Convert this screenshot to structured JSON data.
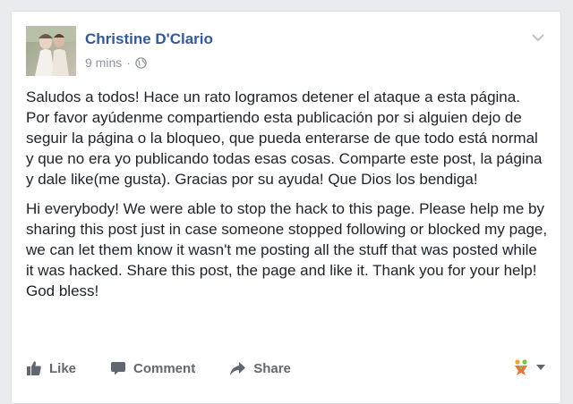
{
  "post": {
    "author": "Christine D'Clario",
    "time": "9 mins",
    "separator": "·",
    "privacy_icon": "globe-icon",
    "menu_icon": "chevron-down-icon",
    "paragraphs": [
      "Saludos a todos! Hace un rato logramos detener el ataque a esta página. Por favor ayúdenme compartiendo esta publicación por si alguien dejo de seguir la página o la bloqueo, que pueda enterarse de que todo está normal y que no era yo publicando todas esas cosas. Comparte este post, la página y dale like(me gusta). Gracias por su ayuda! Que Dios los bendiga!",
      "Hi everybody! We were able to stop the hack to this page. Please help me by sharing this post just in case someone stopped following or blocked my page, we can let them know it wasn't me posting all the stuff that was posted while it was hacked. Share this post, the page and like it. Thank you for your help! God bless!"
    ]
  },
  "actions": {
    "like_label": "Like",
    "comment_label": "Comment",
    "share_label": "Share"
  },
  "colors": {
    "author_link": "#365899",
    "meta_text": "#90949c",
    "body_text": "#1d2129",
    "action_text": "#616770"
  }
}
